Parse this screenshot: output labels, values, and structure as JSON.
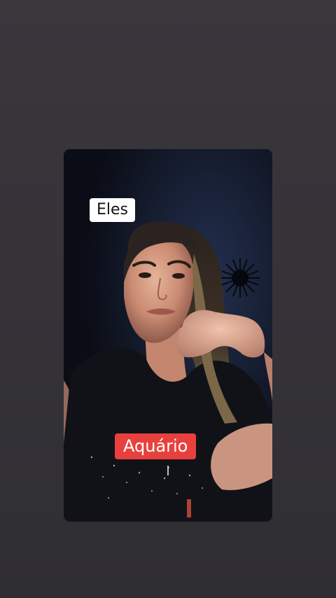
{
  "video": {
    "caption_top": "Eles",
    "caption_bottom": "Aquário",
    "caption_top_bg": "#ffffff",
    "caption_bottom_bg": "#e8413d",
    "page_background": "#363439"
  }
}
